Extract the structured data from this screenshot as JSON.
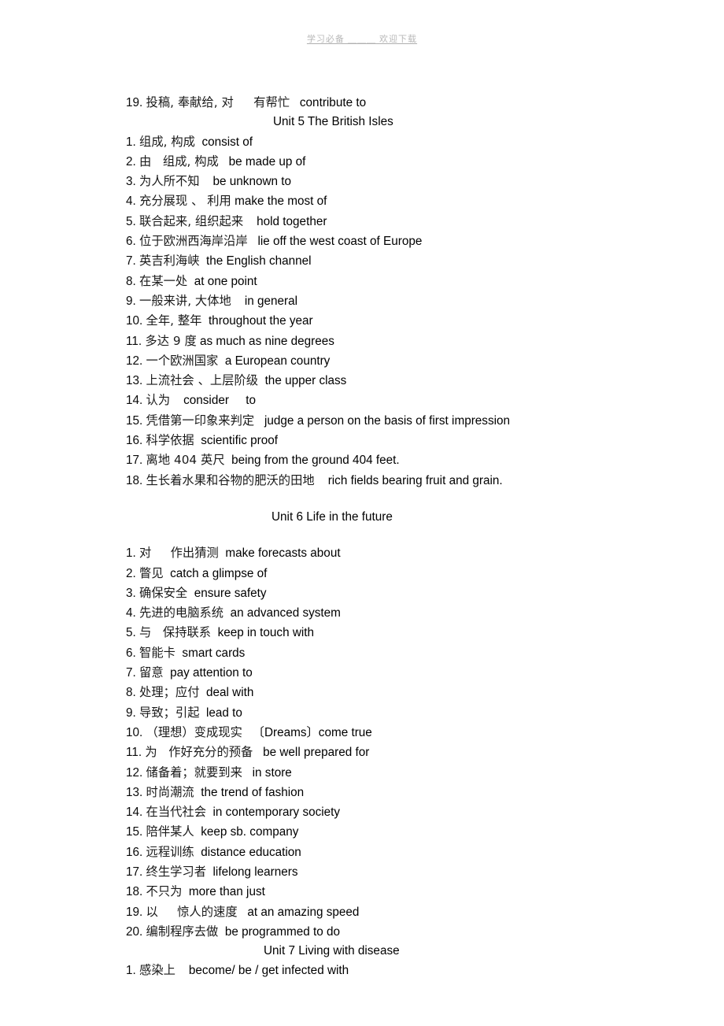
{
  "watermark": {
    "text": "学习必备 ＿＿＿ 欢迎下载"
  },
  "document": {
    "lead_line": {
      "num": "19.",
      "cn": "投稿, 奉献给, 对",
      "cn2": "有帮忙",
      "en": "contribute to"
    },
    "units": [
      {
        "heading": "Unit 5 The British Isles",
        "items": [
          {
            "num": "1.",
            "cn": "组成, 构成",
            "en": "consist of"
          },
          {
            "num": "2.",
            "cn": "由   组成, 构成",
            "en": "be made up of"
          },
          {
            "num": "3.",
            "cn": "为人所不知",
            "en": "be unknown to"
          },
          {
            "num": "4.",
            "cn": "充分展现 、 利用",
            "en": "make the most of"
          },
          {
            "num": "5.",
            "cn": "联合起来, 组织起来",
            "en": "hold together"
          },
          {
            "num": "6.",
            "cn": "位于欧洲西海岸沿岸",
            "en": "lie off the west coast of Europe"
          },
          {
            "num": "7.",
            "cn": "英吉利海峡",
            "en": "the English channel"
          },
          {
            "num": "8.",
            "cn": "在某一处",
            "en": "at one point"
          },
          {
            "num": "9.",
            "cn": "一般来讲, 大体地",
            "en": "in general"
          },
          {
            "num": "10.",
            "cn": "全年, 整年",
            "en": "throughout the year"
          },
          {
            "num": "11.",
            "cn": "多达 9 度",
            "en": "as much as nine degrees"
          },
          {
            "num": "12.",
            "cn": "一个欧洲国家",
            "en": "a European country"
          },
          {
            "num": "13.",
            "cn": "上流社会 、上层阶级",
            "en": "the upper class"
          },
          {
            "num": "14.",
            "cn": "认为",
            "en": "consider     to"
          },
          {
            "num": "15.",
            "cn": "凭借第一印象来判定",
            "en": "judge a person on the basis of first impression"
          },
          {
            "num": "16.",
            "cn": "科学依据",
            "en": "scientific proof"
          },
          {
            "num": "17.",
            "cn": "离地 404 英尺",
            "en": "being from the ground 404 feet."
          },
          {
            "num": "18.",
            "cn": "生长着水果和谷物的肥沃的田地",
            "en": "rich fields bearing fruit and grain."
          }
        ]
      },
      {
        "heading": "Unit 6 Life in the future",
        "items": [
          {
            "num": "1.",
            "cn": "对     作出猜测",
            "en": "make forecasts about"
          },
          {
            "num": "2.",
            "cn": "瞥见",
            "en": "catch a glimpse of"
          },
          {
            "num": "3.",
            "cn": "确保安全",
            "en": "ensure safety"
          },
          {
            "num": "4.",
            "cn": "先进的电脑系统",
            "en": "an advanced system"
          },
          {
            "num": "5.",
            "cn": "与   保持联系",
            "en": "keep in touch with"
          },
          {
            "num": "6.",
            "cn": "智能卡",
            "en": "smart cards"
          },
          {
            "num": "7.",
            "cn": "留意",
            "en": "pay attention to"
          },
          {
            "num": "8.",
            "cn": "处理；应付",
            "en": "deal with"
          },
          {
            "num": "9.",
            "cn": "导致；引起",
            "en": "lead to"
          },
          {
            "num": "10.",
            "cn": "（理想）变成现实",
            "en": "〔Dreams〕come true"
          },
          {
            "num": "11.",
            "cn": "为   作好充分的预备",
            "en": "be well prepared for"
          },
          {
            "num": "12.",
            "cn": "储备着；就要到来",
            "en": "in store"
          },
          {
            "num": "13.",
            "cn": "时尚潮流",
            "en": "the trend of fashion"
          },
          {
            "num": "14.",
            "cn": "在当代社会",
            "en": "in contemporary society"
          },
          {
            "num": "15.",
            "cn": "陪伴某人",
            "en": "keep sb. company"
          },
          {
            "num": "16.",
            "cn": "远程训练",
            "en": "distance education"
          },
          {
            "num": "17.",
            "cn": "终生学习者",
            "en": "lifelong learners"
          },
          {
            "num": "18.",
            "cn": "不只为",
            "en": "more than just"
          },
          {
            "num": "19.",
            "cn": "以     惊人的速度",
            "en": "at an amazing speed"
          },
          {
            "num": "20.",
            "cn": "编制程序去做",
            "en": "be programmed to do"
          }
        ]
      },
      {
        "heading": "Unit 7 Living with disease",
        "items": [
          {
            "num": "1.",
            "cn": "感染上",
            "en": "become/ be / get infected with"
          }
        ]
      }
    ]
  }
}
